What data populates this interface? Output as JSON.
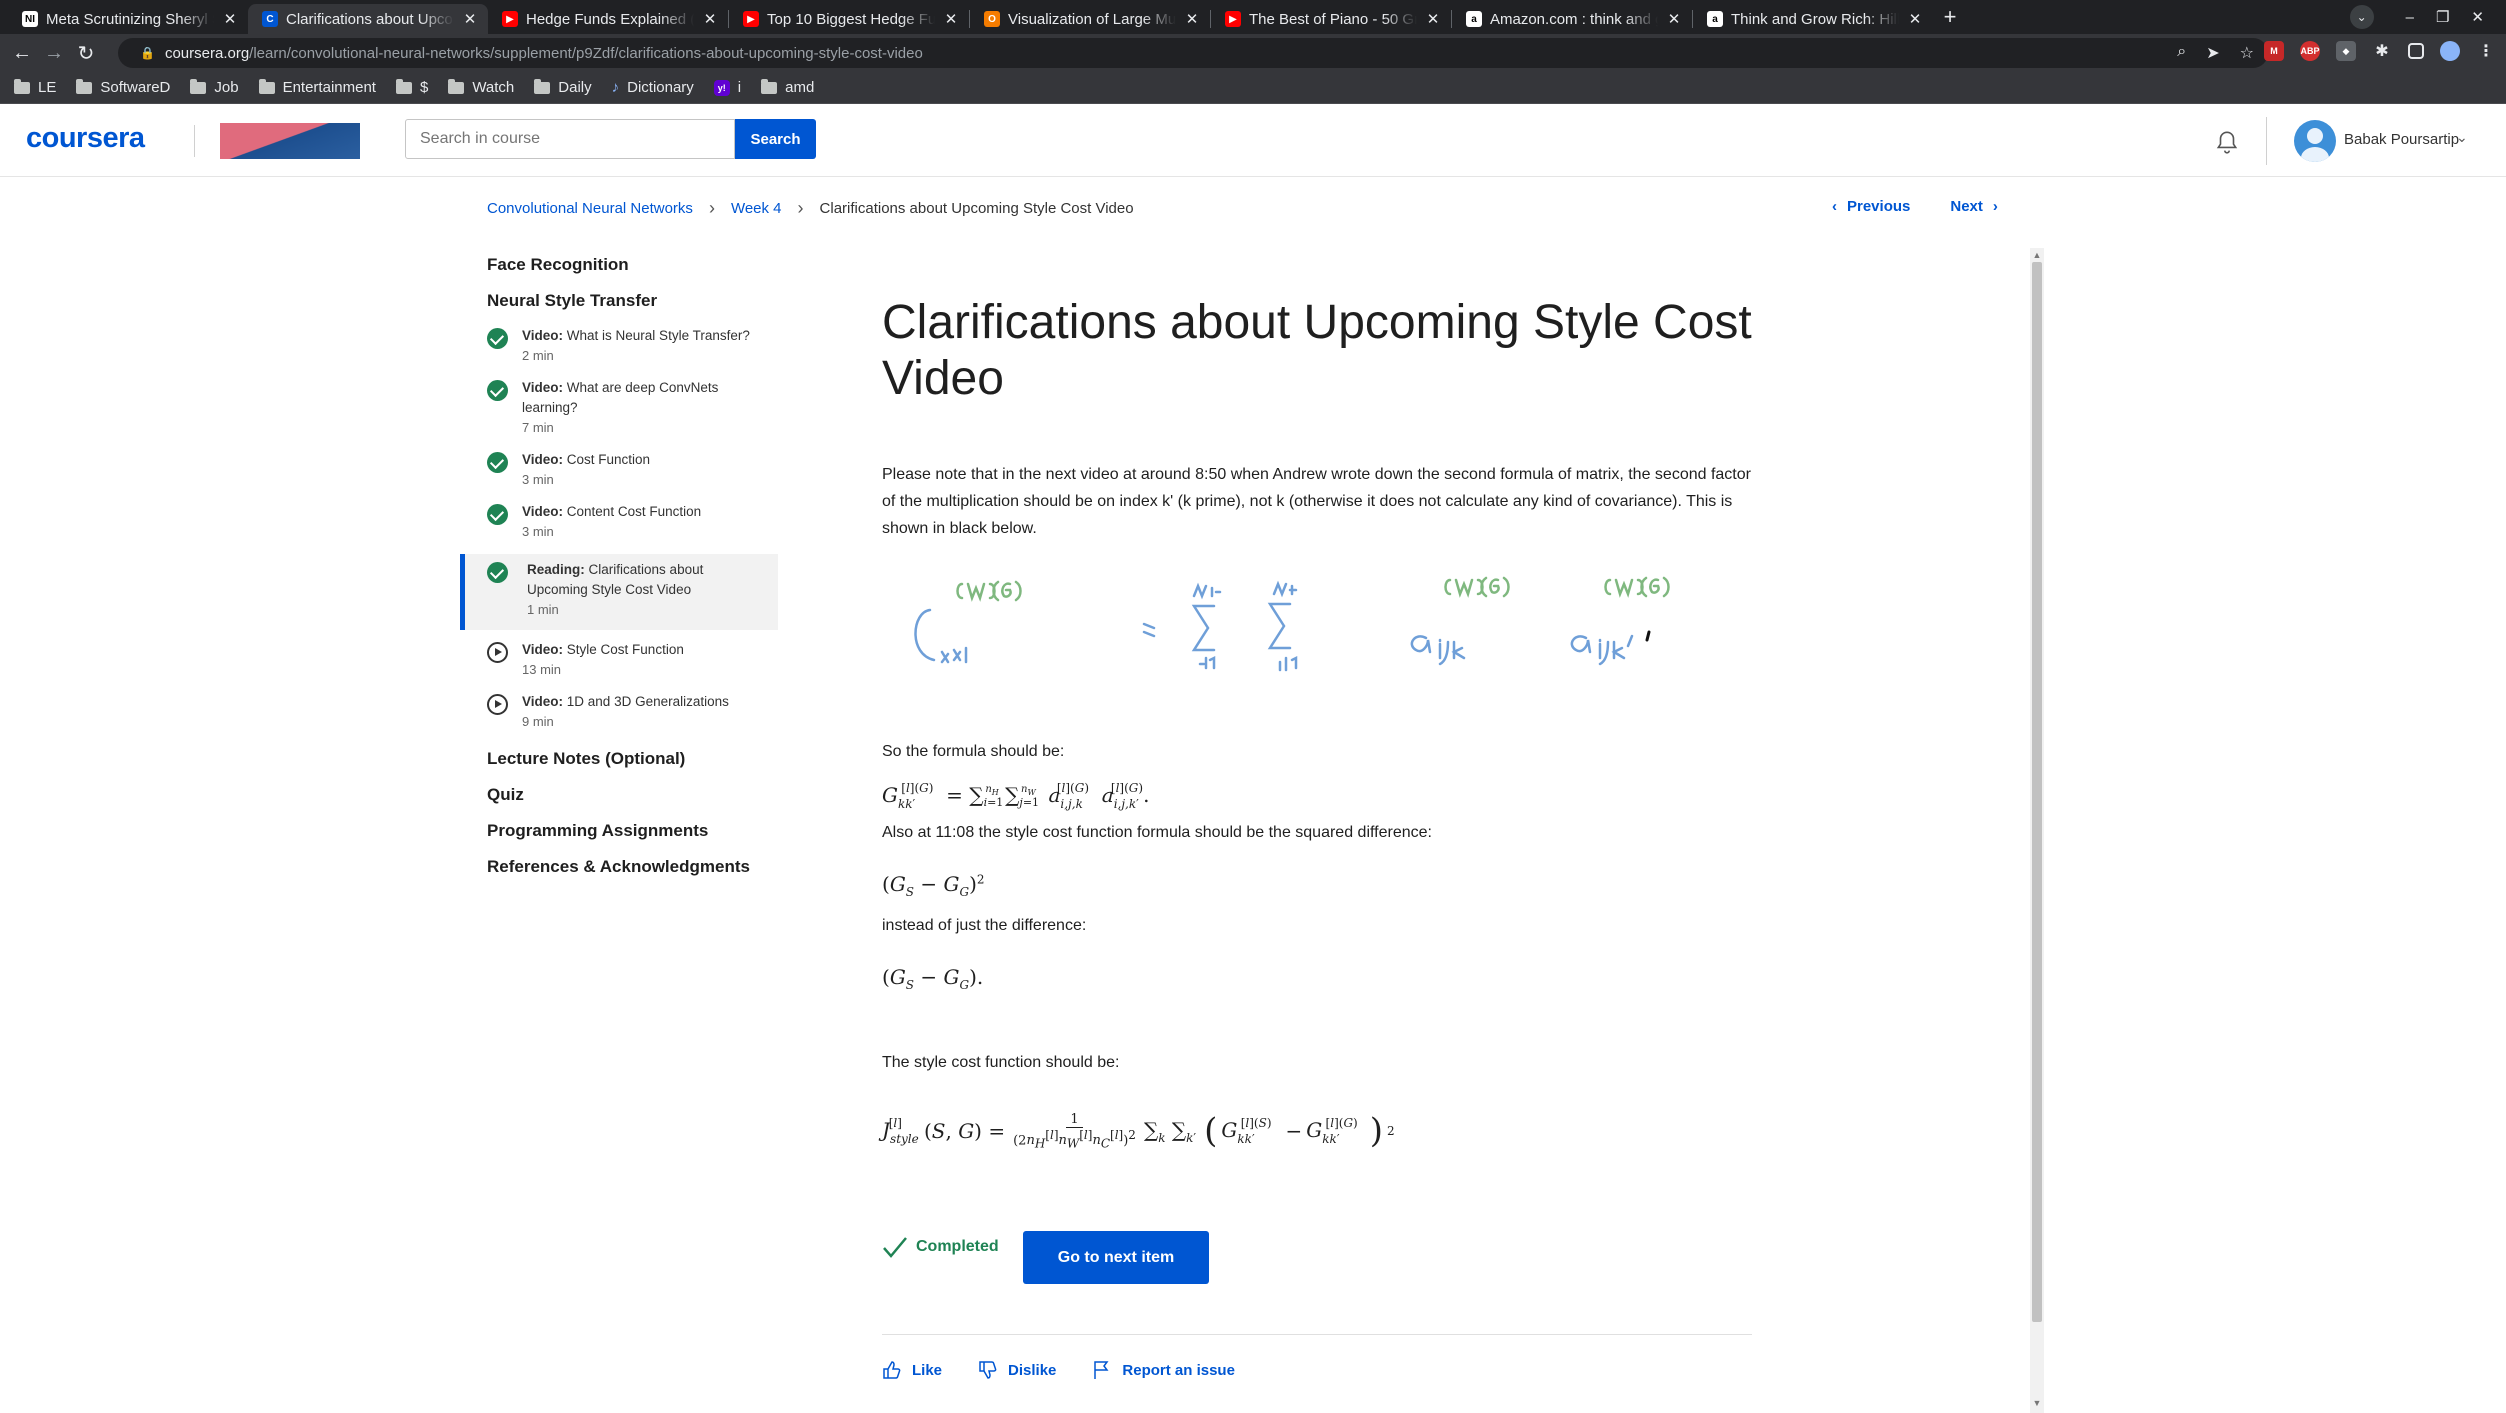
{
  "browser": {
    "tabs": [
      {
        "title": "Meta Scrutinizing Sheryl S",
        "fav": "NI",
        "fav_color": "#ffffff",
        "active": false
      },
      {
        "title": "Clarifications about Upco",
        "fav": "C",
        "fav_color": "#0056d2",
        "active": true
      },
      {
        "title": "Hedge Funds Explained (",
        "fav": "▶",
        "fav_color": "#ff0000",
        "active": false
      },
      {
        "title": "Top 10 Biggest Hedge Fu",
        "fav": "▶",
        "fav_color": "#ff0000",
        "active": false
      },
      {
        "title": "Visualization of Large Mu",
        "fav": "O",
        "fav_color": "#f57c00",
        "active": false
      },
      {
        "title": "The Best of Piano - 50 Gre",
        "fav": "▶",
        "fav_color": "#ff0000",
        "active": false
      },
      {
        "title": "Amazon.com : think and g",
        "fav": "a",
        "fav_color": "#ffffff",
        "active": false
      },
      {
        "title": "Think and Grow Rich: Hill",
        "fav": "a",
        "fav_color": "#ffffff",
        "active": false
      }
    ],
    "url_host": "coursera.org",
    "url_path": "/learn/convolutional-neural-networks/supplement/p9Zdf/clarifications-about-upcoming-style-cost-video",
    "bookmarks": [
      "LE",
      "SoftwareD",
      "Job",
      "Entertainment",
      "$",
      "Watch",
      "Daily",
      "Dictionary",
      "i",
      "amd"
    ]
  },
  "header": {
    "logo": "coursera",
    "search_placeholder": "Search in course",
    "search_button": "Search",
    "user_name": "Babak Poursartip"
  },
  "breadcrumb": {
    "course": "Convolutional Neural Networks",
    "week": "Week 4",
    "current": "Clarifications about Upcoming Style Cost Video"
  },
  "pager": {
    "previous": "Previous",
    "next": "Next"
  },
  "sidebar": {
    "sections": {
      "face": "Face Recognition",
      "nst": "Neural Style Transfer",
      "notes": "Lecture Notes (Optional)",
      "quiz": "Quiz",
      "prog": "Programming Assignments",
      "refs": "References & Acknowledgments"
    },
    "items": [
      {
        "type": "Video:",
        "title": "What is Neural Style Transfer?",
        "duration": "2 min"
      },
      {
        "type": "Video:",
        "title": "What are deep ConvNets learning?",
        "duration": "7 min"
      },
      {
        "type": "Video:",
        "title": "Cost Function",
        "duration": "3 min"
      },
      {
        "type": "Video:",
        "title": "Content Cost Function",
        "duration": "3 min"
      },
      {
        "type": "Reading:",
        "title": "Clarifications about Upcoming Style Cost Video",
        "duration": "1 min"
      },
      {
        "type": "Video:",
        "title": "Style Cost Function",
        "duration": "13 min"
      },
      {
        "type": "Video:",
        "title": "1D and 3D Generalizations",
        "duration": "9 min"
      }
    ]
  },
  "content": {
    "title": "Clarifications about Upcoming Style Cost Video",
    "p1": "Please note that in the next video at around 8:50 when Andrew wrote down the second formula of matrix, the second factor of the multiplication should be on index k' (k prime), not k (otherwise it does not calculate any kind of covariance). This is shown in black below.",
    "p2": "So the formula should be:",
    "p3": "Also at 11:08 the style cost function formula should be the squared difference:",
    "p4": "instead of just the difference:",
    "p5": "The style cost function should be:",
    "completed": "Completed",
    "next_button": "Go to next item"
  },
  "actions": {
    "like": "Like",
    "dislike": "Dislike",
    "report": "Report an issue"
  },
  "colors": {
    "brand": "#0056d2",
    "success": "#1f8354",
    "handwriting": "#7fb87f",
    "handwriting_dark": "#6f9fd8"
  }
}
